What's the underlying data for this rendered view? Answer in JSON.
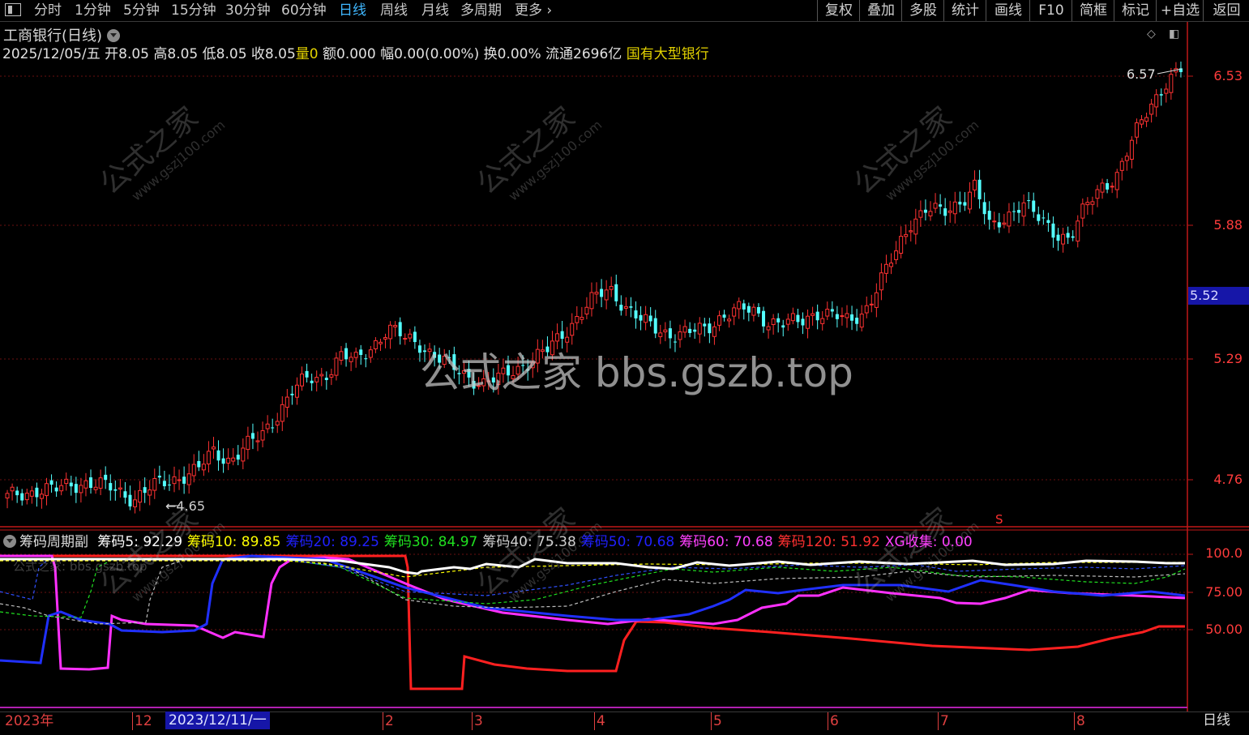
{
  "topbar": {
    "periods": [
      "分时",
      "1分钟",
      "5分钟",
      "15分钟",
      "30分钟",
      "60分钟",
      "日线",
      "周线",
      "月线",
      "多周期",
      "更多"
    ],
    "active_period": "日线",
    "right_buttons": [
      "复权",
      "叠加",
      "多股",
      "统计",
      "画线",
      "F10",
      "简框",
      "标记",
      "+自选",
      "返回"
    ]
  },
  "main": {
    "title": "工商银行(日线)",
    "quote": {
      "date": "2025/12/05/五",
      "open": "开8.05",
      "high": "高8.05",
      "low": "低8.05",
      "close": "收8.05",
      "volume_label": "量",
      "volume": "0",
      "amount": "额0.000",
      "change": "幅0.00(0.00%)",
      "turnover": "换0.00%",
      "float_cap": "流通2696亿",
      "sector": "国有大型银行"
    },
    "price_axis": [
      "6.53",
      "5.88",
      "5.29",
      "4.76"
    ],
    "current_price": "5.52",
    "high_annotation": "6.57",
    "low_annotation": "4.65",
    "marker": "S",
    "watermark_center": "公式之家 bbs.gszb.top",
    "watermark_cn": "公式之家",
    "watermark_url": "www.gszj100.com",
    "colors": {
      "up": "#ff3232",
      "down": "#54ffff"
    }
  },
  "indicator": {
    "name": "筹码周期副",
    "items": [
      {
        "label": "筹码5: 92.29",
        "color": "#ffffff"
      },
      {
        "label": "筹码10: 89.85",
        "color": "#ffff00"
      },
      {
        "label": "筹码20: 89.25",
        "color": "#2020ff"
      },
      {
        "label": "筹码30: 84.97",
        "color": "#20e020"
      },
      {
        "label": "筹码40: 75.38",
        "color": "#cfcfcf"
      },
      {
        "label": "筹码50: 70.68",
        "color": "#2020ff"
      },
      {
        "label": "筹码60: 70.68",
        "color": "#ff40ff"
      },
      {
        "label": "筹码120: 51.92",
        "color": "#ff3030"
      },
      {
        "label": "XG收集: 0.00",
        "color": "#ff40ff"
      }
    ],
    "axis": [
      "100.0",
      "75.00",
      "50.00"
    ],
    "watermark_text": "公式之家: bbs.gszb.top"
  },
  "bottom": {
    "dates": [
      "2023年",
      "12",
      "2",
      "3",
      "4",
      "5",
      "6",
      "7",
      "8"
    ],
    "selected_date": "2023/12/11/一",
    "period": "日线"
  },
  "chart_data": {
    "type": "candlestick",
    "title": "工商银行(日线)",
    "price_axis_ticks": [
      6.53,
      5.88,
      5.29,
      4.76
    ],
    "ylim": [
      4.6,
      6.65
    ],
    "x_labels": [
      "2023年",
      "12",
      "2",
      "3",
      "4",
      "5",
      "6",
      "7",
      "8"
    ],
    "closes_approx": [
      4.68,
      4.7,
      4.72,
      4.71,
      4.74,
      4.75,
      4.73,
      4.71,
      4.68,
      4.72,
      4.75,
      4.78,
      4.8,
      4.88,
      4.85,
      4.9,
      4.95,
      5.05,
      5.15,
      5.2,
      5.22,
      5.3,
      5.28,
      5.35,
      5.42,
      5.38,
      5.36,
      5.3,
      5.25,
      5.22,
      5.18,
      5.2,
      5.25,
      5.28,
      5.32,
      5.4,
      5.48,
      5.55,
      5.6,
      5.52,
      5.45,
      5.42,
      5.4,
      5.4,
      5.42,
      5.48,
      5.5,
      5.5,
      5.46,
      5.44,
      5.45,
      5.5,
      5.48,
      5.45,
      5.5,
      5.62,
      5.75,
      5.9,
      5.95,
      5.92,
      5.98,
      6.05,
      5.85,
      5.92,
      5.98,
      5.9,
      5.85,
      5.82,
      5.95,
      6.05,
      6.1,
      6.25,
      6.4,
      6.5,
      6.55
    ],
    "indicator_series": [
      {
        "name": "筹码5",
        "last": 92.29
      },
      {
        "name": "筹码10",
        "last": 89.85
      },
      {
        "name": "筹码20",
        "last": 89.25
      },
      {
        "name": "筹码30",
        "last": 84.97
      },
      {
        "name": "筹码40",
        "last": 75.38
      },
      {
        "name": "筹码50",
        "last": 70.68
      },
      {
        "name": "筹码60",
        "last": 70.68
      },
      {
        "name": "筹码120",
        "last": 51.92
      },
      {
        "name": "XG收集",
        "last": 0.0
      }
    ],
    "indicator_axis": [
      100.0,
      75.0,
      50.0
    ]
  }
}
